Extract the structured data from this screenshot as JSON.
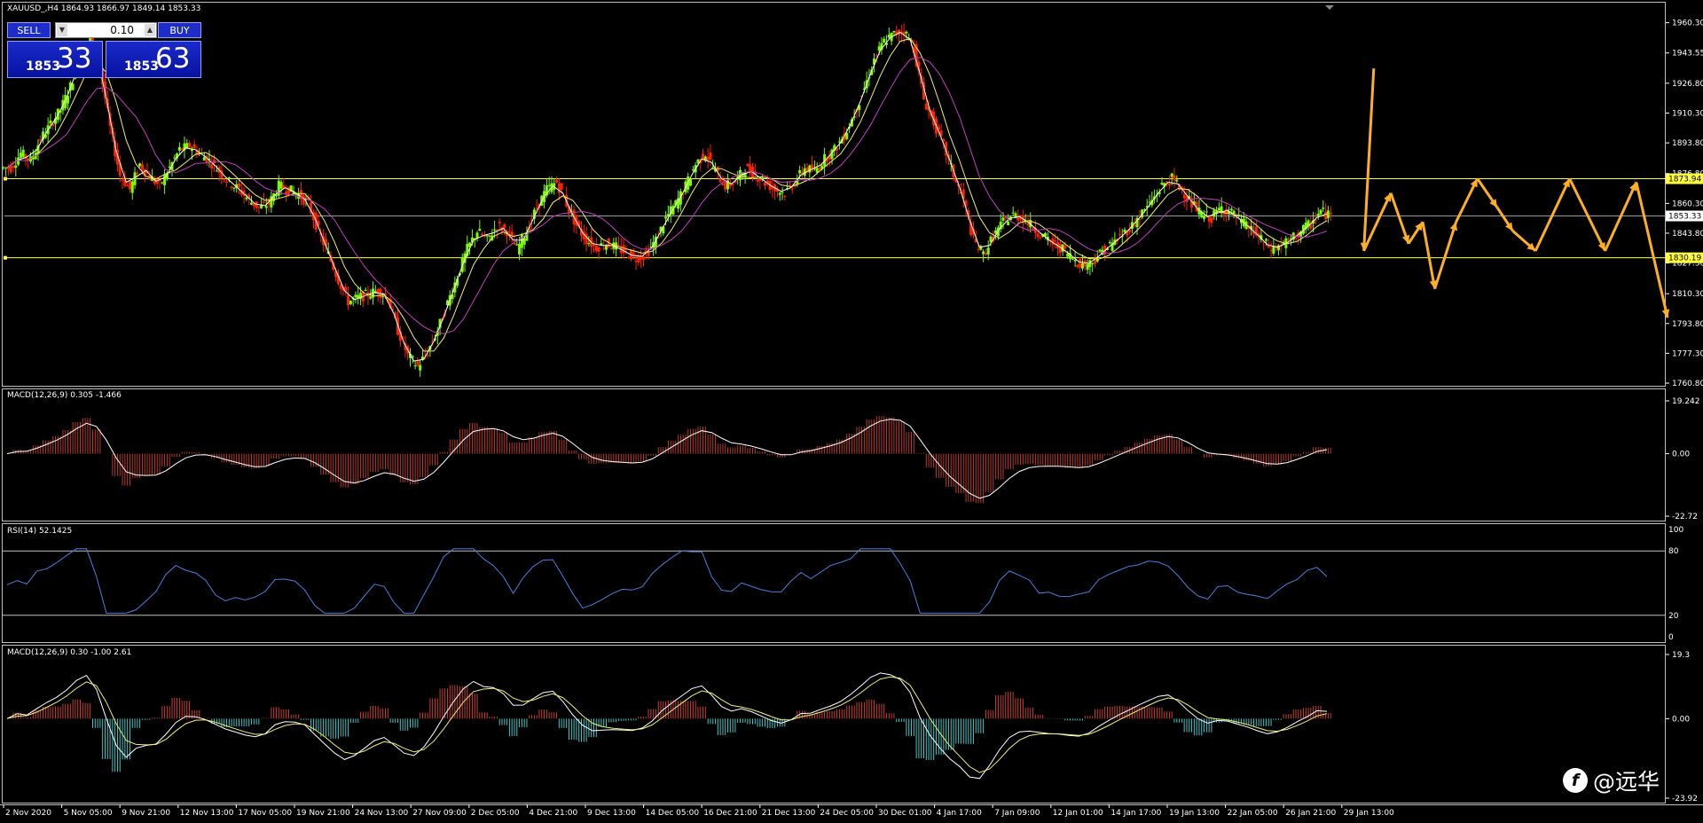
{
  "symbol_header": "XAUUSD_,H4  1864.93 1866.97 1849.14 1853.33",
  "trade_panel": {
    "sell_label": "SELL",
    "buy_label": "BUY",
    "lot_value": "0.10",
    "sell_price_small": "1853",
    "sell_price_big": "33",
    "buy_price_small": "1853",
    "buy_price_big": "63"
  },
  "price_axis": [
    "1960.30",
    "1943.55",
    "1926.80",
    "1910.30",
    "1893.80",
    "1876.80",
    "1860.30",
    "1843.80",
    "1827.30",
    "1810.30",
    "1793.80",
    "1777.30",
    "1760.80"
  ],
  "price_tags": {
    "upper_line": "1873.94",
    "current": "1853.33",
    "lower_line": "1830.19"
  },
  "pane_labels": {
    "macd1": "MACD(12,26,9) 0.305 -1.466",
    "rsi": "RSI(14) 52.1425",
    "macd2": "MACD(12,26,9) 0.30 -1.00 2.61"
  },
  "macd1_axis": [
    "19.242",
    "0.00",
    "-22.72"
  ],
  "rsi_axis": [
    "100",
    "80",
    "20",
    "0"
  ],
  "macd2_axis": [
    "19.3",
    "0.00",
    "-23.92"
  ],
  "time_axis": [
    "2 Nov 2020",
    "5 Nov 05:00",
    "9 Nov 21:00",
    "12 Nov 13:00",
    "17 Nov 05:00",
    "19 Nov 21:00",
    "24 Nov 13:00",
    "27 Nov 09:00",
    "2 Dec 05:00",
    "4 Dec 21:00",
    "9 Dec 13:00",
    "14 Dec 05:00",
    "16 Dec 21:00",
    "21 Dec 13:00",
    "24 Dec 05:00",
    "30 Dec 01:00",
    "4 Jan 17:00",
    "7 Jan 09:00",
    "12 Jan 01:00",
    "14 Jan 17:00",
    "19 Jan 13:00",
    "22 Jan 05:00",
    "26 Jan 21:00",
    "29 Jan 13:00"
  ],
  "watermark": "@远华",
  "colors": {
    "bull_candle": "#7cfc00",
    "bear_candle": "#ff2200",
    "level_line": "#ffff40",
    "arrow": "#ffb020",
    "macd_hist": "#b83a2a",
    "rsi_line": "#4a7fe0",
    "osma_pos": "#c84030",
    "osma_neg": "#40c8c8"
  },
  "chart_data": {
    "type": "line",
    "title": "XAUUSD_,H4",
    "ylim": [
      1760.8,
      1966.0
    ],
    "close": [
      1880,
      1888,
      1884,
      1896,
      1904,
      1912,
      1925,
      1942,
      1952,
      1935,
      1902,
      1876,
      1868,
      1882,
      1875,
      1870,
      1880,
      1890,
      1892,
      1888,
      1884,
      1878,
      1872,
      1868,
      1862,
      1858,
      1860,
      1870,
      1868,
      1865,
      1860,
      1845,
      1832,
      1818,
      1806,
      1808,
      1810,
      1812,
      1808,
      1790,
      1776,
      1770,
      1778,
      1790,
      1805,
      1820,
      1835,
      1845,
      1840,
      1848,
      1845,
      1835,
      1845,
      1858,
      1868,
      1872,
      1860,
      1848,
      1840,
      1836,
      1838,
      1836,
      1833,
      1830,
      1832,
      1840,
      1852,
      1860,
      1870,
      1882,
      1888,
      1878,
      1870,
      1872,
      1880,
      1876,
      1872,
      1868,
      1866,
      1872,
      1880,
      1878,
      1885,
      1890,
      1898,
      1910,
      1924,
      1940,
      1950,
      1954,
      1956,
      1946,
      1918,
      1905,
      1892,
      1876,
      1862,
      1840,
      1832,
      1842,
      1850,
      1854,
      1852,
      1847,
      1842,
      1838,
      1835,
      1830,
      1826,
      1828,
      1834,
      1838,
      1843,
      1848,
      1855,
      1862,
      1870,
      1874,
      1868,
      1860,
      1854,
      1852,
      1858,
      1855,
      1850,
      1846,
      1840,
      1835,
      1837,
      1840,
      1845,
      1849,
      1856,
      1853
    ],
    "pattern_arrow_points": [
      [
        1936,
        1935
      ],
      [
        1922,
        1834
      ],
      [
        1960,
        1866
      ],
      [
        1985,
        1838
      ],
      [
        2005,
        1850
      ],
      [
        2022,
        1813
      ],
      [
        2052,
        1850
      ],
      [
        2082,
        1874
      ],
      [
        2110,
        1858
      ],
      [
        2132,
        1845
      ],
      [
        2164,
        1834
      ],
      [
        2212,
        1874
      ],
      [
        2262,
        1834
      ],
      [
        2306,
        1872
      ],
      [
        2350,
        1797
      ]
    ]
  }
}
